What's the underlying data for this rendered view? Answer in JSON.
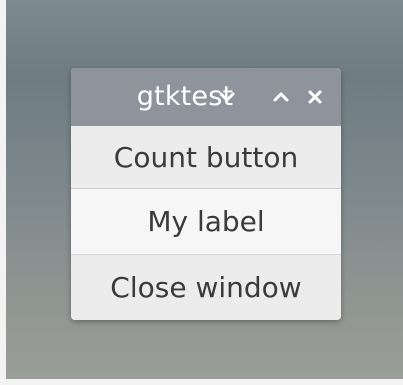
{
  "window": {
    "title": "gtktest"
  },
  "titlebar_buttons": {
    "menu_icon": "chevron-down-icon",
    "maximize_icon": "chevron-up-icon",
    "close_icon": "close-icon"
  },
  "content": {
    "count_button_label": "Count button",
    "my_label_text": "My label",
    "close_window_label": "Close window"
  },
  "colors": {
    "titlebar": "#8f939c",
    "window_background": "#ededed",
    "text": "#3b3b3b",
    "desktop": "#7b878b"
  }
}
